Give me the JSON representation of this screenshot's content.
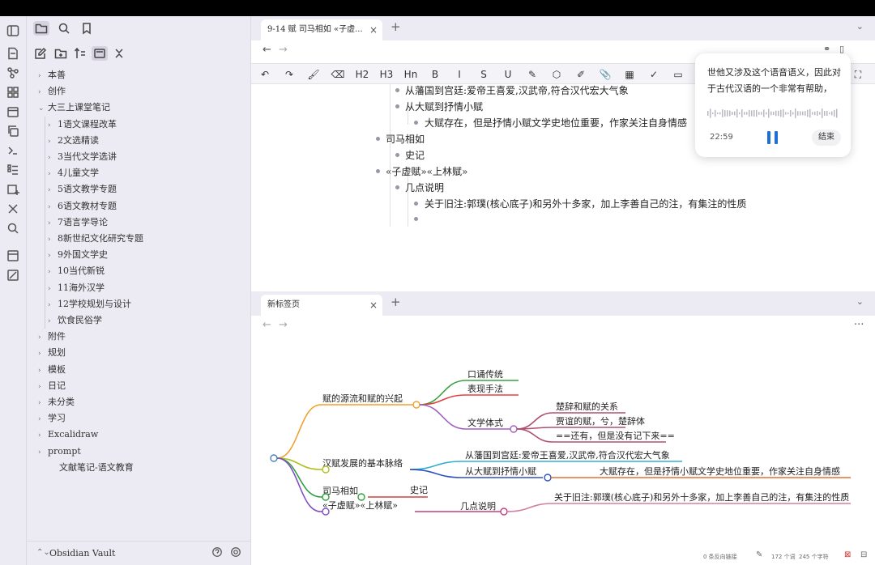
{
  "sidebar": {
    "top_icons": [
      "folder-icon",
      "search-icon",
      "bookmark-icon"
    ],
    "tool_icons": [
      "new-note-icon",
      "new-folder-icon",
      "sort-icon",
      "collapse-view-icon",
      "collapse-all-icon"
    ],
    "tree": [
      {
        "label": "本善",
        "chev": "›"
      },
      {
        "label": "创作",
        "chev": "›"
      },
      {
        "label": "大三上课堂笔记",
        "chev": "⌄"
      },
      {
        "label": "1语文课程改革",
        "chev": "›"
      },
      {
        "label": "2文选精读",
        "chev": "›"
      },
      {
        "label": "3当代文学选讲",
        "chev": "›"
      },
      {
        "label": "4儿童文学",
        "chev": "›"
      },
      {
        "label": "5语文教学专题",
        "chev": "›"
      },
      {
        "label": "6语文教材专题",
        "chev": "›"
      },
      {
        "label": "7语言学导论",
        "chev": "›"
      },
      {
        "label": "8新世纪文化研究专题",
        "chev": "›"
      },
      {
        "label": "9外国文学史",
        "chev": "›"
      },
      {
        "label": "10当代新锐",
        "chev": "›"
      },
      {
        "label": "11海外汉学",
        "chev": "›"
      },
      {
        "label": "12学校规划与设计",
        "chev": "›"
      },
      {
        "label": "饮食民俗学",
        "chev": "›"
      },
      {
        "label": "附件",
        "chev": "›"
      },
      {
        "label": "规划",
        "chev": "›"
      },
      {
        "label": "模板",
        "chev": "›"
      },
      {
        "label": "日记",
        "chev": "›"
      },
      {
        "label": "未分类",
        "chev": "›"
      },
      {
        "label": "学习",
        "chev": "›"
      },
      {
        "label": "Excalidraw",
        "chev": "›"
      },
      {
        "label": "prompt",
        "chev": "›"
      },
      {
        "label": "文献笔记-语文教育",
        "chev": ""
      }
    ],
    "vault_name": "Obsidian Vault",
    "vault_switch": "⌃⌄"
  },
  "top_pane": {
    "tab_title": "9-14 赋 司马相如 «子虚...",
    "tab_close": "×",
    "tab_add": "+",
    "tab_menu": "⌄",
    "nav_back": "←",
    "nav_forward": "→",
    "toolbar": [
      "↶",
      "↷",
      "🖌",
      "⌫",
      "H2",
      "H3",
      "Hn",
      "B",
      "I",
      "S",
      "U",
      "✎",
      "⬡",
      "✐",
      "📎",
      "▦",
      "✓",
      "▭"
    ],
    "lines": [
      {
        "text": "从藩国到宫廷:爱帝王喜爱,汉武帝,符合汉代宏大气象"
      },
      {
        "text": "从大赋到抒情小赋"
      },
      {
        "text": "大赋存在，但是抒情小赋文学史地位重要，作家关注自身情感"
      },
      {
        "text": "司马相如"
      },
      {
        "text": "史记"
      },
      {
        "text": "«子虚赋»«上林赋»"
      },
      {
        "text": "几点说明"
      },
      {
        "text": "关于旧注:郭璞(核心底子)和另外十多家，加上李善自己的注，有集注的性质"
      },
      {
        "text": ""
      }
    ]
  },
  "voice_popup": {
    "transcript": "世他又涉及这个语音语义，因此对于古代汉语的一个非常有帮助，",
    "time": "22:59",
    "end_label": "结束"
  },
  "bottom_pane": {
    "tab_title": "新标签页",
    "tab_close": "×",
    "tab_add": "+",
    "tab_menu": "⌄",
    "nav_back": "←",
    "nav_forward": "→",
    "more": "···"
  },
  "mindmap": {
    "branches": [
      {
        "label": "赋的源流和赋的兴起",
        "color": "#f0a030",
        "children": [
          {
            "label": "口诵传统",
            "color": "#3aa040"
          },
          {
            "label": "表现手法",
            "color": "#e04040"
          },
          {
            "label": "文学体式",
            "color": "#a060c0",
            "children": [
              {
                "label": "楚辞和赋的关系",
                "color": "#b05070"
              },
              {
                "label": "贾谊的赋，兮，楚辞体",
                "color": "#b05070"
              },
              {
                "label": "==还有，但是没有记下来==",
                "color": "#b05070"
              }
            ]
          }
        ]
      },
      {
        "label": "汉赋发展的基本脉络",
        "color": "#b0c020",
        "children": [
          {
            "label": "从藩国到宫廷:爱帝王喜爱,汉武帝,符合汉代宏大气象",
            "color": "#30b0d0"
          },
          {
            "label": "从大赋到抒情小赋",
            "color": "#3050c0",
            "children": [
              {
                "label": "大赋存在，但是抒情小赋文学史地位重要，作家关注自身情感",
                "color": "#e07030"
              }
            ]
          }
        ]
      },
      {
        "label": "司马相如",
        "color": "#30a040",
        "children": [
          {
            "label": "史记",
            "color": "#d04040"
          }
        ]
      },
      {
        "label": "«子虚赋»«上林赋»",
        "color": "#8050c0",
        "children": [
          {
            "label": "几点说明",
            "color": "#c04080",
            "children": [
              {
                "label": "关于旧注:郭璞(核心底子)和另外十多家，加上李善自己的注，有集注的性质",
                "color": "#d080a0"
              }
            ]
          }
        ]
      }
    ]
  },
  "statusbar": {
    "backlinks": "0 条反向链接",
    "words": "172 个词",
    "chars": "245 个字符"
  }
}
